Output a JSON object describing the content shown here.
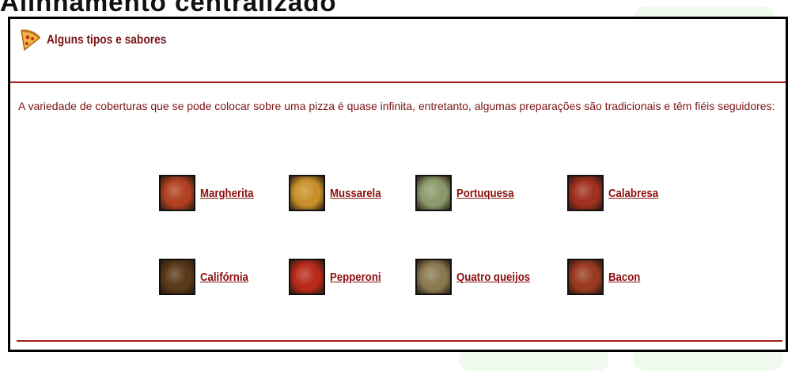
{
  "page": {
    "heading": "Alinhamento centralizado"
  },
  "panel": {
    "title": "Alguns tipos e sabores",
    "title_icon": "pizza-slice-icon",
    "intro": "A variedade de coberturas que se pode colocar sobre uma pizza é quase infinita, entretanto, algumas preparações são tradicionais e têm fiéis seguidores:"
  },
  "flavors": [
    {
      "label": "Margherita",
      "thumb_color": "#b04020"
    },
    {
      "label": "Mussarela",
      "thumb_color": "#c8902a"
    },
    {
      "label": "Portuquesa",
      "thumb_color": "#8a9a6a"
    },
    {
      "label": "Calabresa",
      "thumb_color": "#a03020"
    },
    {
      "label": "Califórnia",
      "thumb_color": "#5a3a1a"
    },
    {
      "label": "Pepperoni",
      "thumb_color": "#b82a1a"
    },
    {
      "label": "Quatro queijos",
      "thumb_color": "#8a7a50"
    },
    {
      "label": "Bacon",
      "thumb_color": "#9a3a20"
    }
  ],
  "colors": {
    "accent": "#8b0f0f",
    "rule": "#a31d1d",
    "text": "#7b1414"
  }
}
